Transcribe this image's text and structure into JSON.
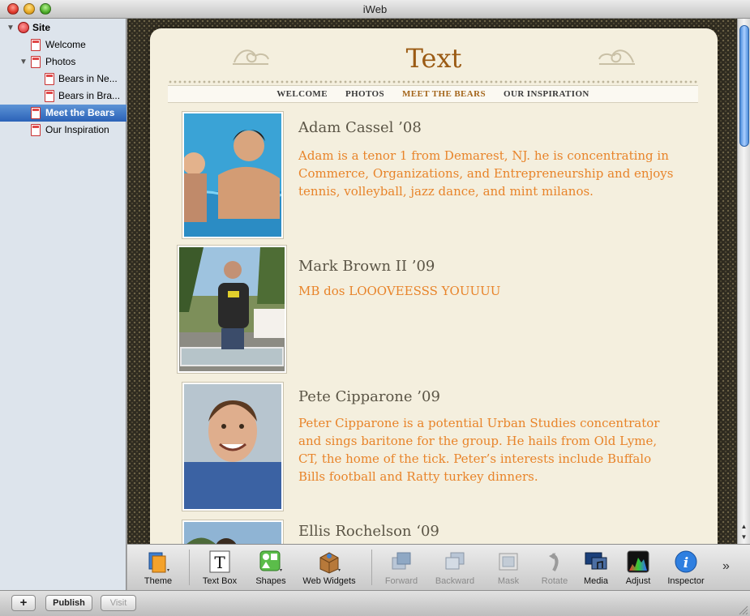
{
  "window": {
    "title": "iWeb"
  },
  "sidebar": {
    "items": [
      {
        "label": "Site"
      },
      {
        "label": "Welcome"
      },
      {
        "label": "Photos"
      },
      {
        "label": "Bears in Ne..."
      },
      {
        "label": "Bears in Bra..."
      },
      {
        "label": "Meet the Bears"
      },
      {
        "label": "Our Inspiration"
      }
    ]
  },
  "page": {
    "title": "Text",
    "nav": [
      "WELCOME",
      "PHOTOS",
      "MEET THE BEARS",
      "OUR INSPIRATION"
    ],
    "active_nav": "MEET THE BEARS",
    "members": [
      {
        "name": "Adam Cassel ’08",
        "desc": "Adam is a tenor 1 from Demarest, NJ. he is concentrating in Commerce, Organizations, and Entrepreneurship and enjoys tennis, volleyball, jazz dance, and mint milanos."
      },
      {
        "name": "Mark Brown II ’09",
        "desc": "MB dos LOOOVEESSS YOUUUU"
      },
      {
        "name": "Pete Cipparone ’09",
        "desc": "Peter Cipparone is a potential Urban Studies concentrator and sings baritone for the group. He hails from Old Lyme, CT, the home of the tick. Peter’s interests include Buffalo Bills football and Ratty turkey dinners."
      },
      {
        "name": "Ellis Rochelson ‘09",
        "desc": ""
      }
    ]
  },
  "toolbar": {
    "buttons": [
      {
        "label": "Theme",
        "icon": "theme-icon"
      },
      {
        "label": "Text Box",
        "icon": "text-box-icon"
      },
      {
        "label": "Shapes",
        "icon": "shapes-icon"
      },
      {
        "label": "Web Widgets",
        "icon": "web-widgets-icon"
      },
      {
        "label": "Forward",
        "icon": "forward-icon"
      },
      {
        "label": "Backward",
        "icon": "backward-icon"
      },
      {
        "label": "Mask",
        "icon": "mask-icon"
      },
      {
        "label": "Rotate",
        "icon": "rotate-icon"
      },
      {
        "label": "Media",
        "icon": "media-icon"
      },
      {
        "label": "Adjust",
        "icon": "adjust-icon"
      },
      {
        "label": "Inspector",
        "icon": "inspector-icon"
      }
    ],
    "overflow": "»"
  },
  "bottombar": {
    "add": "+",
    "publish": "Publish",
    "visit": "Visit"
  },
  "colors": {
    "accent_text": "#e8842a",
    "selection": "#2b62b8",
    "title": "#9b5b14"
  }
}
